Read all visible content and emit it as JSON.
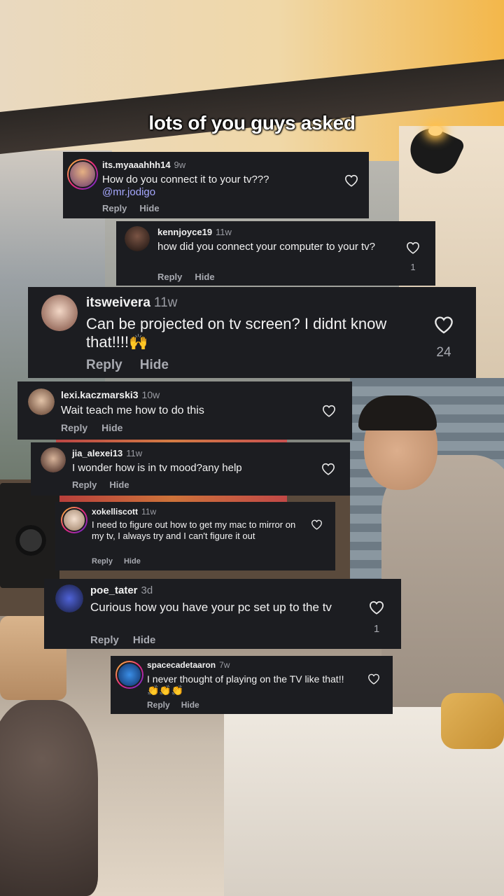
{
  "caption": "lots of you guys asked",
  "comments": [
    {
      "user": "its.myaaahhh14",
      "time": "9w",
      "text": "How do you connect it to your tv???",
      "mention": "@mr.jodigo",
      "reply": "Reply",
      "hide": "Hide",
      "likes": ""
    },
    {
      "user": "kennjoyce19",
      "time": "11w",
      "text": "how did you connect your computer to your tv?",
      "reply": "Reply",
      "hide": "Hide",
      "likes": "1"
    },
    {
      "user": "itsweivera",
      "time": "11w",
      "text": "Can be projected on tv screen? I didnt know that!!!!🙌",
      "reply": "Reply",
      "hide": "Hide",
      "likes": "24"
    },
    {
      "user": "lexi.kaczmarski3",
      "time": "10w",
      "text": "Wait teach me how to do this",
      "reply": "Reply",
      "hide": "Hide",
      "likes": ""
    },
    {
      "user": "jia_alexei13",
      "time": "11w",
      "text": "I wonder how is in tv mood?any help",
      "reply": "Reply",
      "hide": "Hide",
      "likes": ""
    },
    {
      "user": "xokelliscott",
      "time": "11w",
      "text": "I need to figure out how to get my mac to mirror on my tv, I always try and I can't figure it out",
      "reply": "Reply",
      "hide": "Hide",
      "likes": ""
    },
    {
      "user": "poe_tater",
      "time": "3d",
      "text": "Curious how you have your pc set up to the tv",
      "reply": "Reply",
      "hide": "Hide",
      "likes": "1"
    },
    {
      "user": "spacecadetaaron",
      "time": "7w",
      "text": "I never thought of playing on the TV like that!! 👏👏👏",
      "reply": "Reply",
      "hide": "Hide",
      "likes": ""
    }
  ],
  "colors": {
    "card_bg": "#1c1d21",
    "mention": "#a6a8ff",
    "muted": "#a8aab1"
  },
  "icons": {
    "heart": "heart-outline-icon"
  }
}
